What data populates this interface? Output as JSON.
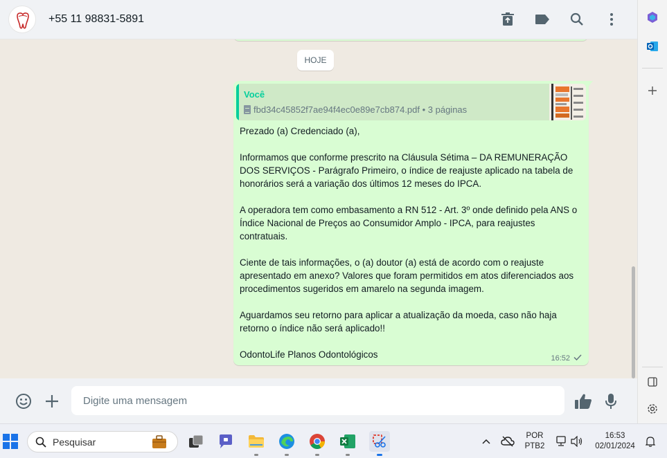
{
  "header": {
    "contact": "+55 11 98831-5891"
  },
  "chat": {
    "day_label": "HOJE",
    "message": {
      "quote_author": "Você",
      "quote_file": "fbd34c45852f7ae94f4ec0e89e7cb874.pdf • 3 páginas",
      "paragraphs": [
        "Prezado (a) Credenciado (a),",
        "Informamos que conforme prescrito na Cláusula Sétima – DA REMUNERAÇÃO DOS SERVIÇOS - Parágrafo Primeiro, o índice de reajuste aplicado na tabela de honorários será a variação dos últimos 12 meses do IPCA.",
        "A operadora tem como embasamento a RN 512 - Art. 3º onde definido pela ANS o Índice Nacional de Preços ao Consumidor Amplo - IPCA, para reajustes contratuais.",
        "Ciente de tais informações, o (a) doutor (a) está de acordo com o reajuste apresentado em anexo? Valores que foram permitidos em atos diferenciados aos procedimentos sugeridos em amarelo na segunda imagem.",
        "Aguardamos seu retorno para aplicar a atualização da moeda, caso não haja retorno o índice não será aplicado!!",
        "OdontoLife Planos Odontológicos"
      ],
      "time": "16:52",
      "status_icon": "single-check-icon"
    }
  },
  "composer": {
    "placeholder": "Digite uma mensagem"
  },
  "taskbar": {
    "search_label": "Pesquisar",
    "lang_top": "POR",
    "lang_bottom": "PTB2",
    "time": "16:53",
    "date": "02/01/2024"
  },
  "colors": {
    "bubble": "#d9fdd3",
    "accent": "#06cf9c",
    "header_bg": "#f0f2f5",
    "chat_bg": "#efeae2"
  }
}
